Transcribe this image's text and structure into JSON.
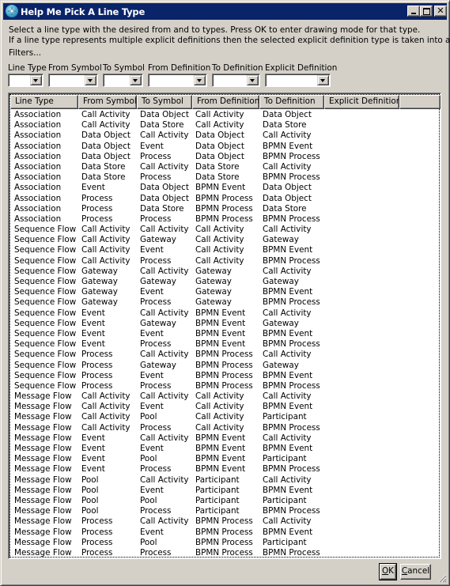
{
  "window": {
    "title": "Help Me Pick A Line Type",
    "icon": "bpmn-app-icon",
    "controls": {
      "minimize": "minimize-icon",
      "maximize": "maximize-icon",
      "close": "close-icon"
    }
  },
  "instructions": {
    "line1": "Select a line type with the desired from and to types. Press OK to enter drawing mode for that type.",
    "line2": "If a line type represents multiple explicit definitions then the selected explicit definition type is taken into account."
  },
  "filters": {
    "label": "Filters...",
    "fields": [
      {
        "label": "Line Type",
        "value": ""
      },
      {
        "label": "From Symbol",
        "value": ""
      },
      {
        "label": "To Symbol",
        "value": ""
      },
      {
        "label": "From Definition",
        "value": ""
      },
      {
        "label": "To Definition",
        "value": ""
      },
      {
        "label": "Explicit Definition",
        "value": ""
      }
    ]
  },
  "table": {
    "columns": [
      "Line Type",
      "From Symbol",
      "To Symbol",
      "From Definition",
      "To Definition",
      "Explicit Definition"
    ],
    "rows": [
      [
        "Association",
        "Call Activity",
        "Data Object",
        "Call Activity",
        "Data Object",
        ""
      ],
      [
        "Association",
        "Call Activity",
        "Data Store",
        "Call Activity",
        "Data Store",
        ""
      ],
      [
        "Association",
        "Data Object",
        "Call Activity",
        "Data Object",
        "Call Activity",
        ""
      ],
      [
        "Association",
        "Data Object",
        "Event",
        "Data Object",
        "BPMN Event",
        ""
      ],
      [
        "Association",
        "Data Object",
        "Process",
        "Data Object",
        "BPMN Process",
        ""
      ],
      [
        "Association",
        "Data Store",
        "Call Activity",
        "Data Store",
        "Call Activity",
        ""
      ],
      [
        "Association",
        "Data Store",
        "Process",
        "Data Store",
        "BPMN Process",
        ""
      ],
      [
        "Association",
        "Event",
        "Data Object",
        "BPMN Event",
        "Data Object",
        ""
      ],
      [
        "Association",
        "Process",
        "Data Object",
        "BPMN Process",
        "Data Object",
        ""
      ],
      [
        "Association",
        "Process",
        "Data Store",
        "BPMN Process",
        "Data Store",
        ""
      ],
      [
        "Association",
        "Process",
        "Process",
        "BPMN Process",
        "BPMN Process",
        ""
      ],
      [
        "Sequence Flow",
        "Call Activity",
        "Call Activity",
        "Call Activity",
        "Call Activity",
        ""
      ],
      [
        "Sequence Flow",
        "Call Activity",
        "Gateway",
        "Call Activity",
        "Gateway",
        ""
      ],
      [
        "Sequence Flow",
        "Call Activity",
        "Event",
        "Call Activity",
        "BPMN Event",
        ""
      ],
      [
        "Sequence Flow",
        "Call Activity",
        "Process",
        "Call Activity",
        "BPMN Process",
        ""
      ],
      [
        "Sequence Flow",
        "Gateway",
        "Call Activity",
        "Gateway",
        "Call Activity",
        ""
      ],
      [
        "Sequence Flow",
        "Gateway",
        "Gateway",
        "Gateway",
        "Gateway",
        ""
      ],
      [
        "Sequence Flow",
        "Gateway",
        "Event",
        "Gateway",
        "BPMN Event",
        ""
      ],
      [
        "Sequence Flow",
        "Gateway",
        "Process",
        "Gateway",
        "BPMN Process",
        ""
      ],
      [
        "Sequence Flow",
        "Event",
        "Call Activity",
        "BPMN Event",
        "Call Activity",
        ""
      ],
      [
        "Sequence Flow",
        "Event",
        "Gateway",
        "BPMN Event",
        "Gateway",
        ""
      ],
      [
        "Sequence Flow",
        "Event",
        "Event",
        "BPMN Event",
        "BPMN Event",
        ""
      ],
      [
        "Sequence Flow",
        "Event",
        "Process",
        "BPMN Event",
        "BPMN Process",
        ""
      ],
      [
        "Sequence Flow",
        "Process",
        "Call Activity",
        "BPMN Process",
        "Call Activity",
        ""
      ],
      [
        "Sequence Flow",
        "Process",
        "Gateway",
        "BPMN Process",
        "Gateway",
        ""
      ],
      [
        "Sequence Flow",
        "Process",
        "Event",
        "BPMN Process",
        "BPMN Event",
        ""
      ],
      [
        "Sequence Flow",
        "Process",
        "Process",
        "BPMN Process",
        "BPMN Process",
        ""
      ],
      [
        "Message Flow",
        "Call Activity",
        "Call Activity",
        "Call Activity",
        "Call Activity",
        ""
      ],
      [
        "Message Flow",
        "Call Activity",
        "Event",
        "Call Activity",
        "BPMN Event",
        ""
      ],
      [
        "Message Flow",
        "Call Activity",
        "Pool",
        "Call Activity",
        "Participant",
        ""
      ],
      [
        "Message Flow",
        "Call Activity",
        "Process",
        "Call Activity",
        "BPMN Process",
        ""
      ],
      [
        "Message Flow",
        "Event",
        "Call Activity",
        "BPMN Event",
        "Call Activity",
        ""
      ],
      [
        "Message Flow",
        "Event",
        "Event",
        "BPMN Event",
        "BPMN Event",
        ""
      ],
      [
        "Message Flow",
        "Event",
        "Pool",
        "BPMN Event",
        "Participant",
        ""
      ],
      [
        "Message Flow",
        "Event",
        "Process",
        "BPMN Event",
        "BPMN Process",
        ""
      ],
      [
        "Message Flow",
        "Pool",
        "Call Activity",
        "Participant",
        "Call Activity",
        ""
      ],
      [
        "Message Flow",
        "Pool",
        "Event",
        "Participant",
        "BPMN Event",
        ""
      ],
      [
        "Message Flow",
        "Pool",
        "Pool",
        "Participant",
        "Participant",
        ""
      ],
      [
        "Message Flow",
        "Pool",
        "Process",
        "Participant",
        "BPMN Process",
        ""
      ],
      [
        "Message Flow",
        "Process",
        "Call Activity",
        "BPMN Process",
        "Call Activity",
        ""
      ],
      [
        "Message Flow",
        "Process",
        "Event",
        "BPMN Process",
        "BPMN Event",
        ""
      ],
      [
        "Message Flow",
        "Process",
        "Pool",
        "BPMN Process",
        "Participant",
        ""
      ],
      [
        "Message Flow",
        "Process",
        "Process",
        "BPMN Process",
        "BPMN Process",
        ""
      ]
    ]
  },
  "buttons": {
    "ok": {
      "mnemonic": "O",
      "rest": "K"
    },
    "cancel": {
      "mnemonic": "C",
      "rest": "ancel"
    }
  }
}
